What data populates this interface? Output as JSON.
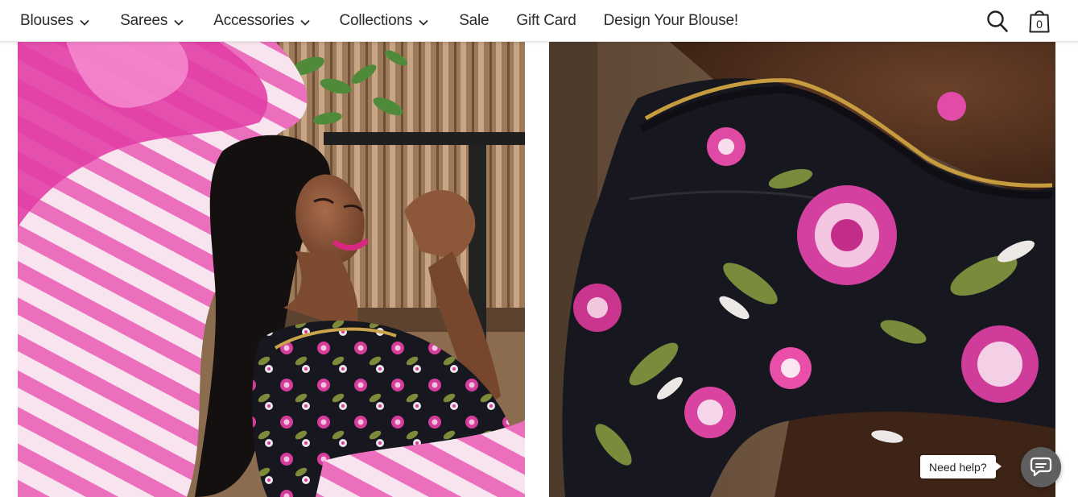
{
  "nav": {
    "items": [
      {
        "label": "Blouses",
        "has_dropdown": true
      },
      {
        "label": "Sarees",
        "has_dropdown": true
      },
      {
        "label": "Accessories",
        "has_dropdown": true
      },
      {
        "label": "Collections",
        "has_dropdown": true
      },
      {
        "label": "Sale",
        "has_dropdown": false
      },
      {
        "label": "Gift Card",
        "has_dropdown": false
      },
      {
        "label": "Design Your Blouse!",
        "has_dropdown": false
      }
    ]
  },
  "header_icons": {
    "search_icon": "search-icon",
    "cart_icon": "shopping-bag-icon",
    "cart_count": "0"
  },
  "gallery": {
    "images": [
      {
        "name": "model-in-floral-blouse-and-pink-saree",
        "subject": "photo"
      },
      {
        "name": "floral-blouse-sleeve-closeup",
        "subject": "photo"
      }
    ]
  },
  "help_widget": {
    "bubble_text": "Need help?",
    "icon": "chat-icon"
  },
  "colors": {
    "header_bg": "#ffffff",
    "nav_text": "#2b2b2b",
    "chat_button": "#5f5f5f",
    "saree_pink": "#e44fb0",
    "blouse_black": "#1a1a24"
  }
}
